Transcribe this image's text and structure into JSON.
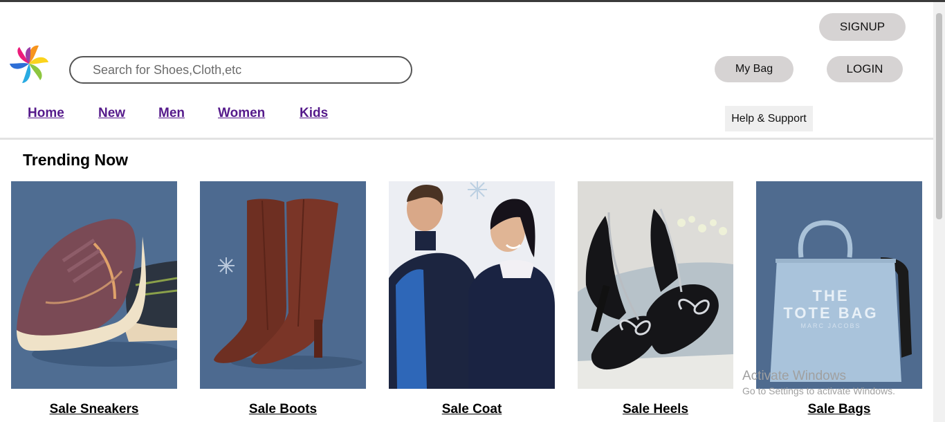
{
  "header": {
    "search_placeholder": "Search for Shoes,Cloth,etc",
    "signup_label": "SIGNUP",
    "mybag_label": "My Bag",
    "login_label": "LOGIN",
    "help_label": "Help & Support"
  },
  "nav": {
    "items": [
      {
        "label": "Home"
      },
      {
        "label": "New"
      },
      {
        "label": "Men"
      },
      {
        "label": "Women"
      },
      {
        "label": "Kids"
      }
    ]
  },
  "trending": {
    "title": "Trending Now",
    "cards": [
      {
        "label": "Sale Sneakers",
        "image": "sneakers-photo"
      },
      {
        "label": "Sale Boots",
        "image": "boots-photo"
      },
      {
        "label": "Sale Coat",
        "image": "coat-photo"
      },
      {
        "label": "Sale Heels",
        "image": "heels-photo"
      },
      {
        "label": "Sale Bags",
        "image": "bag-photo"
      }
    ]
  },
  "bag_print": {
    "line1": "THE",
    "line2": "TOTE BAG",
    "line3": "MARC JACOBS"
  },
  "watermark": {
    "line1": "Activate Windows",
    "line2": "Go to Settings to activate Windows."
  },
  "colors": {
    "link": "#551a8b",
    "pill": "#d6d3d3",
    "photo_blue": "#4d6a90"
  }
}
